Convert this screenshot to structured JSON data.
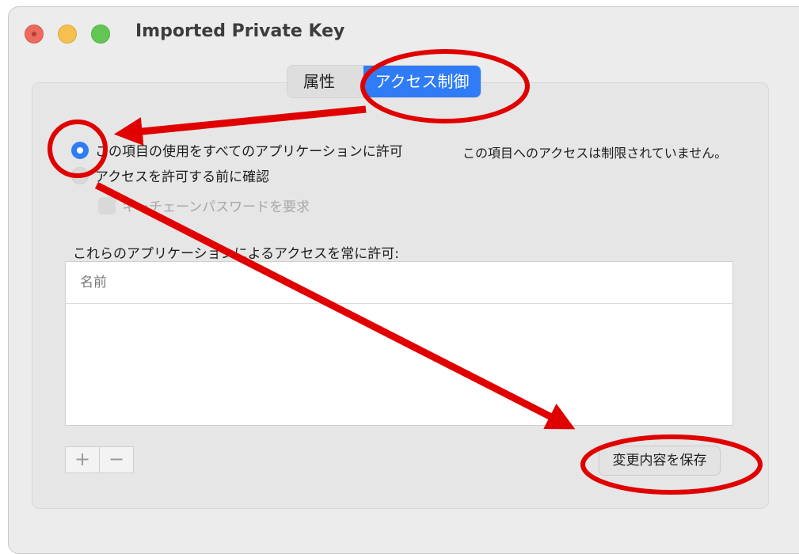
{
  "window": {
    "title": "Imported Private Key"
  },
  "tabs": [
    {
      "label": "属性",
      "active": false
    },
    {
      "label": "アクセス制御",
      "active": true
    }
  ],
  "access": {
    "allow_all": {
      "label": "この項目の使用をすべてのアプリケーションに許可",
      "selected": true
    },
    "status_text": "この項目へのアクセスは制限されていません。",
    "confirm_before": {
      "label": "アクセスを許可する前に確認",
      "selected": false
    },
    "require_keychain_password": {
      "label": "キーチェーンパスワードを要求",
      "checked": false,
      "enabled": false
    },
    "always_allow_label": "これらのアプリケーションによるアクセスを常に許可:",
    "table": {
      "columns": [
        "名前"
      ],
      "rows": []
    },
    "add_label": "+",
    "remove_label": "−",
    "save_label": "変更内容を保存"
  },
  "colors": {
    "accent": "#2f7cf6",
    "annotation": "#e00000"
  },
  "annotations": [
    {
      "shape": "ellipse",
      "target": "tab-access-control"
    },
    {
      "shape": "circle",
      "target": "allow-all-radio"
    },
    {
      "shape": "ellipse",
      "target": "save-changes-button"
    },
    {
      "shape": "arrow",
      "from": "tab-access-control",
      "to": "allow-all-radio"
    },
    {
      "shape": "arrow",
      "from": "allow-all-radio",
      "to": "save-changes-button"
    }
  ]
}
